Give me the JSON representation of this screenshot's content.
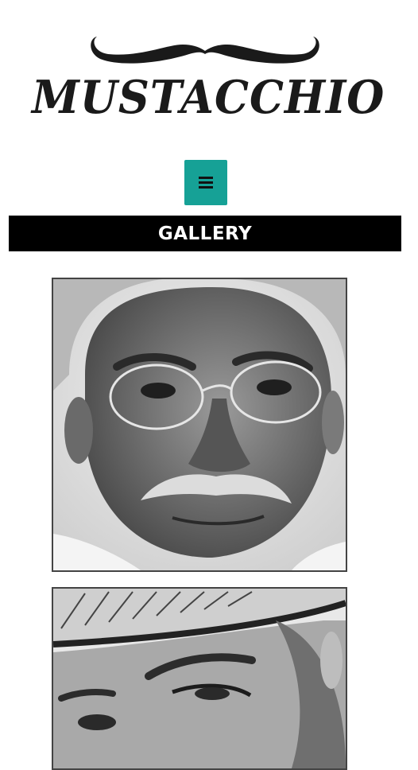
{
  "brand": {
    "name": "MUSTACCHIO",
    "logo_icon": "mustache-icon"
  },
  "nav": {
    "menu_icon": "hamburger-icon",
    "accent_color": "#16a196"
  },
  "page": {
    "title": "GALLERY"
  },
  "gallery": {
    "images": [
      {
        "name": "gallery-image-1"
      },
      {
        "name": "gallery-image-2"
      }
    ]
  }
}
